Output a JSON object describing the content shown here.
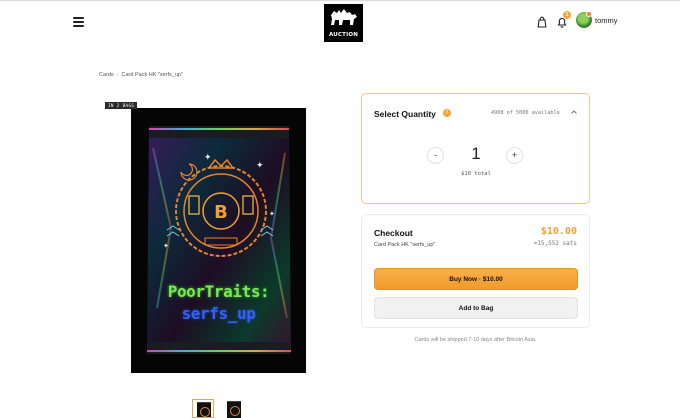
{
  "header": {
    "logo_text": "AUCTION",
    "username": "tommy",
    "notification_count": "1",
    "icons": [
      "menu-icon",
      "bag-icon",
      "bell-icon",
      "avatar"
    ]
  },
  "breadcrumb": {
    "items": [
      "Cards",
      "Card Pack HK \"serfs_up\""
    ]
  },
  "product": {
    "bags_tag": "IN 2 BAGS",
    "pack_line1": "PoorTraits:",
    "pack_line2": "serfs_up"
  },
  "quantity": {
    "title": "Select Quantity",
    "info": "!",
    "availability": "4908 of 5000 available",
    "value": "1",
    "minus": "-",
    "plus": "+",
    "total": "$10 total"
  },
  "checkout": {
    "title": "Checkout",
    "price": "$10.00",
    "item": "Card Pack HK \"serfs_up\"",
    "sats": "≈15,552 sats",
    "buy_label": "Buy Now · $10.00",
    "bag_label": "Add to Bag"
  },
  "shipping_note": "Cards will be shipped 7-10 days after Bitcoin Asia.",
  "colors": {
    "accent": "#f4a63b",
    "price": "#f0a038",
    "border_active": "#f3c58a"
  }
}
